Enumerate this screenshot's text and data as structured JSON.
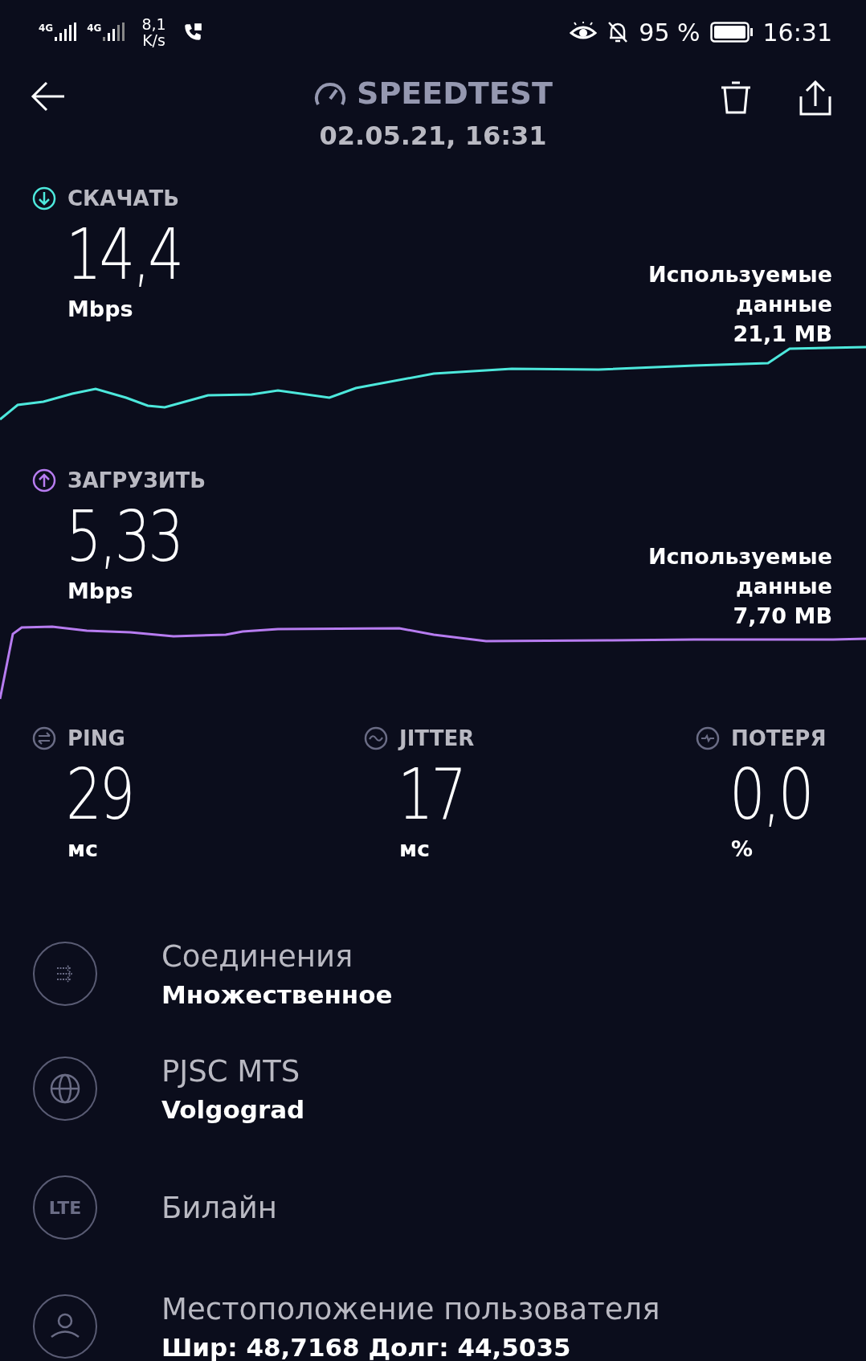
{
  "status_bar": {
    "network_1": "4G",
    "network_2": "4G",
    "speed_value": "8,1",
    "speed_unit": "K/s",
    "battery": "95 %",
    "time": "16:31"
  },
  "header": {
    "title": "SPEEDTEST",
    "date": "02.05.21, 16:31"
  },
  "transfers": [
    {
      "kind": "download",
      "label": "СКАЧАТЬ",
      "value": "14,4",
      "unit": "Mbps",
      "data_label": "Используемые данные",
      "data_value": "21,1 MB",
      "color": "#4de8dc"
    },
    {
      "kind": "upload",
      "label": "ЗАГРУЗИТЬ",
      "value": "5,33",
      "unit": "Mbps",
      "data_label": "Используемые данные",
      "data_value": "7,70 MB",
      "color": "#b77cf0"
    }
  ],
  "stats": [
    {
      "kind": "ping",
      "label": "PING",
      "value": "29",
      "unit": "мс"
    },
    {
      "kind": "jitter",
      "label": "JITTER",
      "value": "17",
      "unit": "мс"
    },
    {
      "kind": "loss",
      "label": "ПОТЕРЯ",
      "value": "0,0",
      "unit": "%"
    }
  ],
  "details": [
    {
      "kind": "connections",
      "title": "Соединения",
      "subtitle": "Множественное"
    },
    {
      "kind": "server",
      "title": "PJSC MTS",
      "subtitle": "Volgograd"
    },
    {
      "kind": "carrier",
      "icon_text": "LTE",
      "title": "Билайн"
    },
    {
      "kind": "location",
      "title": "Местоположение пользователя",
      "subtitle": "Шир: 48,7168 Долг: 44,5035"
    }
  ]
}
